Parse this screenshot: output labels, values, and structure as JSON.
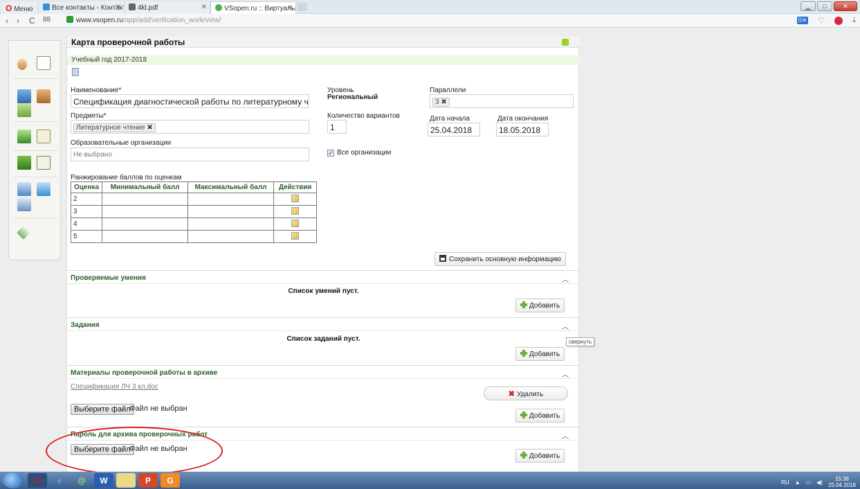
{
  "browser": {
    "tabs": [
      {
        "label": "Меню"
      },
      {
        "label": "Все контакты - Контакты"
      },
      {
        "label": "4kl.pdf"
      },
      {
        "label": "VSopen.ru :: Виртуальная"
      }
    ],
    "url_host": "www.vsopen.ru",
    "url_path": "/app/add/verification_work/view/"
  },
  "card": {
    "title": "Карта проверочной работы",
    "year": "Учебный год 2017-2018"
  },
  "form": {
    "name_label": "Наименование*",
    "name_value": "Спецификация диагностической работы по литературному чтению для",
    "subjects_label": "Предметы*",
    "subject_chip": "Литературное чтение",
    "orgs_label": "Образовательные организации",
    "orgs_placeholder": "Не выбрано",
    "level_label": "Уровень",
    "level_value": "Региональный",
    "variants_label": "Количество вариантов",
    "variants_value": "1",
    "all_orgs_label": "Все организации",
    "all_orgs_checked": true,
    "parallels_label": "Параллели",
    "parallel_chip": "3",
    "start_label": "Дата начала",
    "start_value": "25.04.2018",
    "end_label": "Дата окончания",
    "end_value": "18.05.2018"
  },
  "ranking": {
    "label": "Ранжирование баллов по оценкам",
    "headers": [
      "Оценка",
      "Минимальный балл",
      "Максимальный балл",
      "Действия"
    ],
    "rows": [
      {
        "grade": "2",
        "min": "",
        "max": ""
      },
      {
        "grade": "3",
        "min": "",
        "max": ""
      },
      {
        "grade": "4",
        "min": "",
        "max": ""
      },
      {
        "grade": "5",
        "min": "",
        "max": ""
      }
    ]
  },
  "save_button": "Сохранить основную информацию",
  "sections": {
    "skills_title": "Проверяемые умения",
    "skills_empty": "Список умений пуст.",
    "tasks_title": "Задания",
    "tasks_empty": "Список заданий пуст.",
    "archive_title": "Материалы проверочной работы в архиве",
    "archive_file": "Спецификация ЛЧ 3 кл.doc",
    "delete_label": "Удалить",
    "password_title": "Пароль для архива проверочных работ"
  },
  "add_label": "Добавить",
  "file_input": {
    "button": "Выберите файл",
    "status": "Файл не выбран"
  },
  "tooltip": "свернуть",
  "tray": {
    "lang": "RU",
    "time": "15:38",
    "date": "25.04.2018"
  },
  "colors": {
    "section_title": "#2b5e2b",
    "year_bar": "#edf7e1",
    "highlight_ellipse": "#d91c1c",
    "add_icon": "#6cae3c"
  }
}
